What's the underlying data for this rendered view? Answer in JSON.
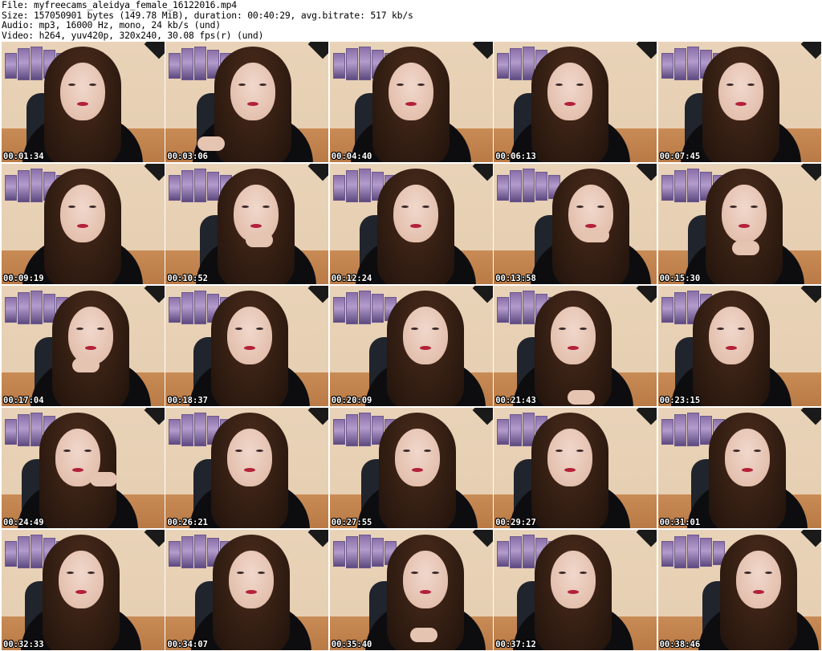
{
  "header": {
    "file_line": "File: myfreecams_aleidya_female_16122016.mp4",
    "size_line": "Size: 157050901 bytes (149.78 MiB), duration: 00:40:29, avg.bitrate: 517 kb/s",
    "audio_line": "Audio: mp3, 16000 Hz, mono, 24 kb/s (und)",
    "video_line": "Video: h264, yuv420p, 320x240, 30.08 fps(r) (und)"
  },
  "thumbnails": [
    {
      "timestamp": "00:01:34"
    },
    {
      "timestamp": "00:03:06"
    },
    {
      "timestamp": "00:04:40"
    },
    {
      "timestamp": "00:06:13"
    },
    {
      "timestamp": "00:07:45"
    },
    {
      "timestamp": "00:09:19"
    },
    {
      "timestamp": "00:10:52"
    },
    {
      "timestamp": "00:12:24"
    },
    {
      "timestamp": "00:13:58"
    },
    {
      "timestamp": "00:15:30"
    },
    {
      "timestamp": "00:17:04"
    },
    {
      "timestamp": "00:18:37"
    },
    {
      "timestamp": "00:20:09"
    },
    {
      "timestamp": "00:21:43"
    },
    {
      "timestamp": "00:23:15"
    },
    {
      "timestamp": "00:24:49"
    },
    {
      "timestamp": "00:26:21"
    },
    {
      "timestamp": "00:27:55"
    },
    {
      "timestamp": "00:29:27"
    },
    {
      "timestamp": "00:31:01"
    },
    {
      "timestamp": "00:32:33"
    },
    {
      "timestamp": "00:34:07"
    },
    {
      "timestamp": "00:35:40"
    },
    {
      "timestamp": "00:37:12"
    },
    {
      "timestamp": "00:38:46"
    }
  ]
}
